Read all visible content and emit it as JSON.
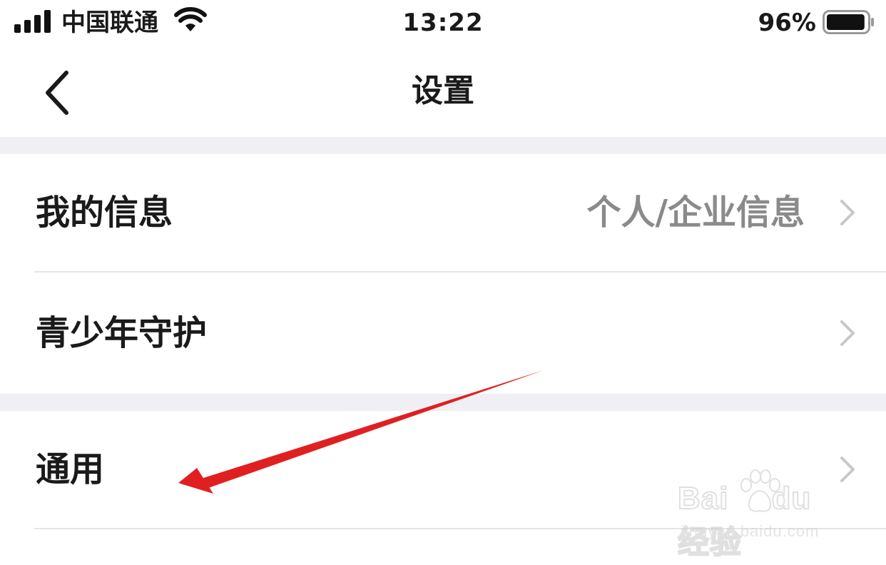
{
  "status_bar": {
    "carrier": "中国联通",
    "time": "13:22",
    "battery_percent": "96%",
    "battery_level": 0.96,
    "icons": [
      "signal-icon",
      "wifi-icon",
      "battery-icon"
    ]
  },
  "nav": {
    "title": "设置",
    "back_icon": "chevron-left-icon"
  },
  "settings": {
    "my_info": {
      "label": "我的信息",
      "value": "个人/企业信息"
    },
    "youth_protection": {
      "label": "青少年守护"
    },
    "general": {
      "label": "通用"
    }
  },
  "annotation": {
    "color": "#e02020"
  },
  "watermark": {
    "brand": "Bai",
    "brand_suffix": "du",
    "brand_cn": "经验",
    "url": "jingyan.baidu.com"
  },
  "colors": {
    "group_gap": "#efeff4",
    "secondary_text": "#8a8a8a",
    "chevron": "#c7c7cc"
  }
}
